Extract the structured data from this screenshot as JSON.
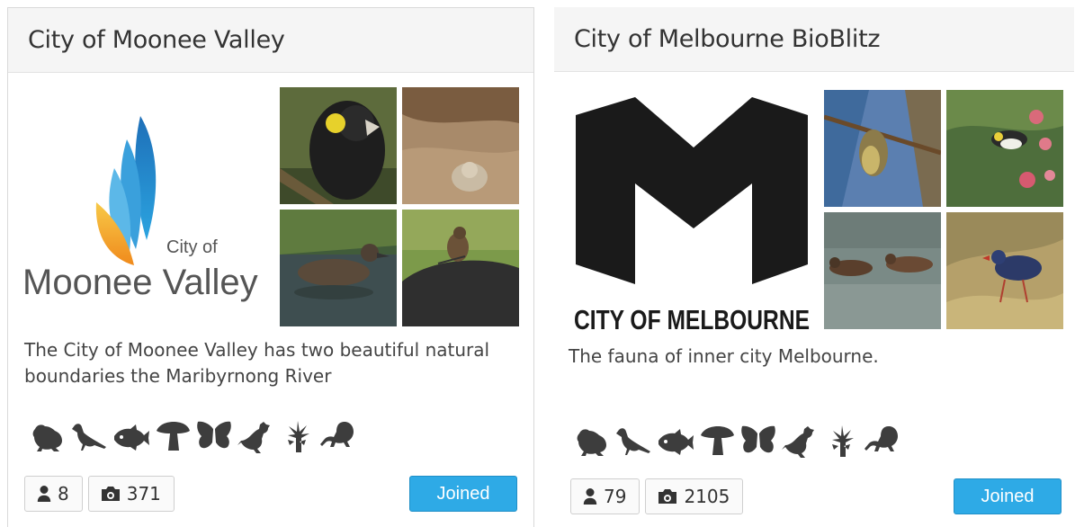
{
  "cards": [
    {
      "title": "City of Moonee Valley",
      "logo": {
        "small_text": "City of",
        "big_text": "Moonee Valley"
      },
      "photos": [
        "yellow-tailed-black-cockatoo",
        "owl-on-rock",
        "duck-swimming",
        "bird-on-rock"
      ],
      "description": "The City of Moonee Valley has two beautiful natural boundaries the Maribyrnong River",
      "taxa_icons": [
        "frog-icon",
        "bird-icon",
        "fish-icon",
        "mushroom-icon",
        "butterfly-icon",
        "kangaroo-icon",
        "plant-icon",
        "lizard-icon"
      ],
      "members": "8",
      "observations": "371",
      "joined_label": "Joined"
    },
    {
      "title": "City of Melbourne BioBlitz",
      "logo": {
        "text": "CITY OF MELBOURNE"
      },
      "photos": [
        "honeyeater-on-branch",
        "honeyeater-in-flowers",
        "ducks-on-water",
        "swamphen-in-grass"
      ],
      "description": "The fauna of inner city Melbourne.",
      "taxa_icons": [
        "frog-icon",
        "bird-icon",
        "fish-icon",
        "mushroom-icon",
        "butterfly-icon",
        "kangaroo-icon",
        "plant-icon",
        "lizard-icon"
      ],
      "members": "79",
      "observations": "2105",
      "joined_label": "Joined"
    }
  ],
  "colors": {
    "accent": "#2eaae6",
    "icon": "#3d3d3d",
    "header_bg": "#f5f5f5"
  }
}
